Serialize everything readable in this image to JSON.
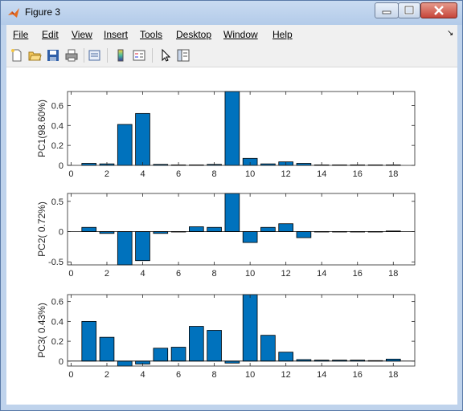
{
  "window": {
    "title": "Figure 3"
  },
  "menu": {
    "items": [
      "File",
      "Edit",
      "View",
      "Insert",
      "Tools",
      "Desktop",
      "Window",
      "Help"
    ]
  },
  "toolbar": {
    "icons": [
      "new-figure-icon",
      "open-file-icon",
      "save-icon",
      "print-icon",
      "print-preview-icon",
      "insert-colorbar-icon",
      "insert-legend-icon",
      "edit-plot-icon",
      "property-editor-icon"
    ]
  },
  "colors": {
    "bar": "#0072BD",
    "bar_edge": "#000000"
  },
  "chart_data": [
    {
      "type": "bar",
      "ylabel": "PC1(98.60%)",
      "x": [
        1,
        2,
        3,
        4,
        5,
        6,
        7,
        8,
        9,
        10,
        11,
        12,
        13,
        14,
        15,
        16,
        17,
        18
      ],
      "values": [
        0.02,
        0.015,
        0.41,
        0.52,
        0.01,
        0.005,
        0.005,
        0.01,
        0.74,
        0.07,
        0.015,
        0.035,
        0.02,
        0.005,
        0.005,
        0.005,
        0.005,
        0.005
      ],
      "xlim": [
        -0.2,
        19.2
      ],
      "ylim": [
        0,
        0.74
      ],
      "yticks": [
        0,
        0.2,
        0.4,
        0.6
      ],
      "ytick_labels": [
        "0",
        "0.2",
        "0.4",
        "0.6"
      ],
      "xticks": [
        0,
        2,
        4,
        6,
        8,
        10,
        12,
        14,
        16,
        18
      ],
      "xtick_labels": [
        "0",
        "2",
        "4",
        "6",
        "8",
        "10",
        "12",
        "14",
        "16",
        "18"
      ]
    },
    {
      "type": "bar",
      "ylabel": "PC2( 0.72%)",
      "x": [
        1,
        2,
        3,
        4,
        5,
        6,
        7,
        8,
        9,
        10,
        11,
        12,
        13,
        14,
        15,
        16,
        17,
        18
      ],
      "values": [
        0.07,
        -0.03,
        -0.55,
        -0.48,
        -0.03,
        0.0,
        0.08,
        0.07,
        0.63,
        -0.18,
        0.07,
        0.13,
        -0.1,
        0.0,
        0.0,
        0.0,
        0.0,
        0.01
      ],
      "xlim": [
        -0.2,
        19.2
      ],
      "ylim": [
        -0.55,
        0.63
      ],
      "yticks": [
        -0.5,
        0,
        0.5
      ],
      "ytick_labels": [
        "-0.5",
        "0",
        "0.5"
      ],
      "xticks": [
        0,
        2,
        4,
        6,
        8,
        10,
        12,
        14,
        16,
        18
      ],
      "xtick_labels": [
        "0",
        "2",
        "4",
        "6",
        "8",
        "10",
        "12",
        "14",
        "16",
        "18"
      ]
    },
    {
      "type": "bar",
      "ylabel": "PC3( 0.43%)",
      "x": [
        1,
        2,
        3,
        4,
        5,
        6,
        7,
        8,
        9,
        10,
        11,
        12,
        13,
        14,
        15,
        16,
        17,
        18
      ],
      "values": [
        0.4,
        0.24,
        -0.05,
        -0.03,
        0.13,
        0.14,
        0.35,
        0.31,
        -0.02,
        0.67,
        0.26,
        0.09,
        0.015,
        0.01,
        0.01,
        0.01,
        0.005,
        0.02
      ],
      "xlim": [
        -0.2,
        19.2
      ],
      "ylim": [
        -0.05,
        0.67
      ],
      "yticks": [
        0,
        0.2,
        0.4,
        0.6
      ],
      "ytick_labels": [
        "0",
        "0.2",
        "0.4",
        "0.6"
      ],
      "xticks": [
        0,
        2,
        4,
        6,
        8,
        10,
        12,
        14,
        16,
        18
      ],
      "xtick_labels": [
        "0",
        "2",
        "4",
        "6",
        "8",
        "10",
        "12",
        "14",
        "16",
        "18"
      ]
    }
  ]
}
